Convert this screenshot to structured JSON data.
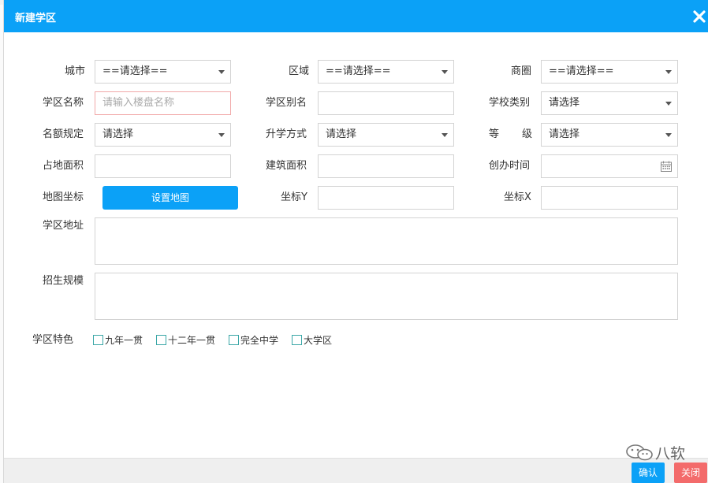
{
  "dialog": {
    "title": "新建学区"
  },
  "row1": {
    "city": {
      "label": "城市",
      "value": "==请选择=="
    },
    "district": {
      "label": "区域",
      "value": "==请选择=="
    },
    "business_circle": {
      "label": "商圈",
      "value": "==请选择=="
    }
  },
  "row2": {
    "school_district_name": {
      "label": "学区名称",
      "placeholder": "请输入楼盘名称"
    },
    "school_district_alias": {
      "label": "学区别名",
      "value": ""
    },
    "school_type": {
      "label": "学校类别",
      "value": "请选择"
    }
  },
  "row3": {
    "quota_rule": {
      "label": "名额规定",
      "value": "请选择"
    },
    "admission_method": {
      "label": "升学方式",
      "value": "请选择"
    },
    "grade": {
      "label_a": "等",
      "label_b": "级",
      "value": "请选择"
    }
  },
  "row4": {
    "land_area": {
      "label": "占地面积",
      "value": ""
    },
    "building_area": {
      "label": "建筑面积",
      "value": ""
    },
    "founded_time": {
      "label": "创办时间",
      "value": "",
      "icon": "calendar-icon"
    }
  },
  "row5": {
    "map_coord": {
      "label": "地图坐标",
      "button": "设置地图"
    },
    "coord_y": {
      "label": "坐标Y",
      "value": ""
    },
    "coord_x": {
      "label": "坐标X",
      "value": ""
    }
  },
  "address": {
    "label": "学区地址",
    "value": ""
  },
  "enrollment_scale": {
    "label": "招生规模",
    "value": ""
  },
  "features": {
    "label": "学区特色",
    "options": [
      "九年一贯",
      "十二年一贯",
      "完全中学",
      "大学区"
    ],
    "checkbox_color": "#3aa7a7"
  },
  "footer": {
    "confirm": "确认",
    "close": "关闭"
  },
  "watermark": {
    "text": "八软"
  },
  "colors": {
    "primary": "#0ba1f7",
    "danger": "#f36b6b"
  }
}
